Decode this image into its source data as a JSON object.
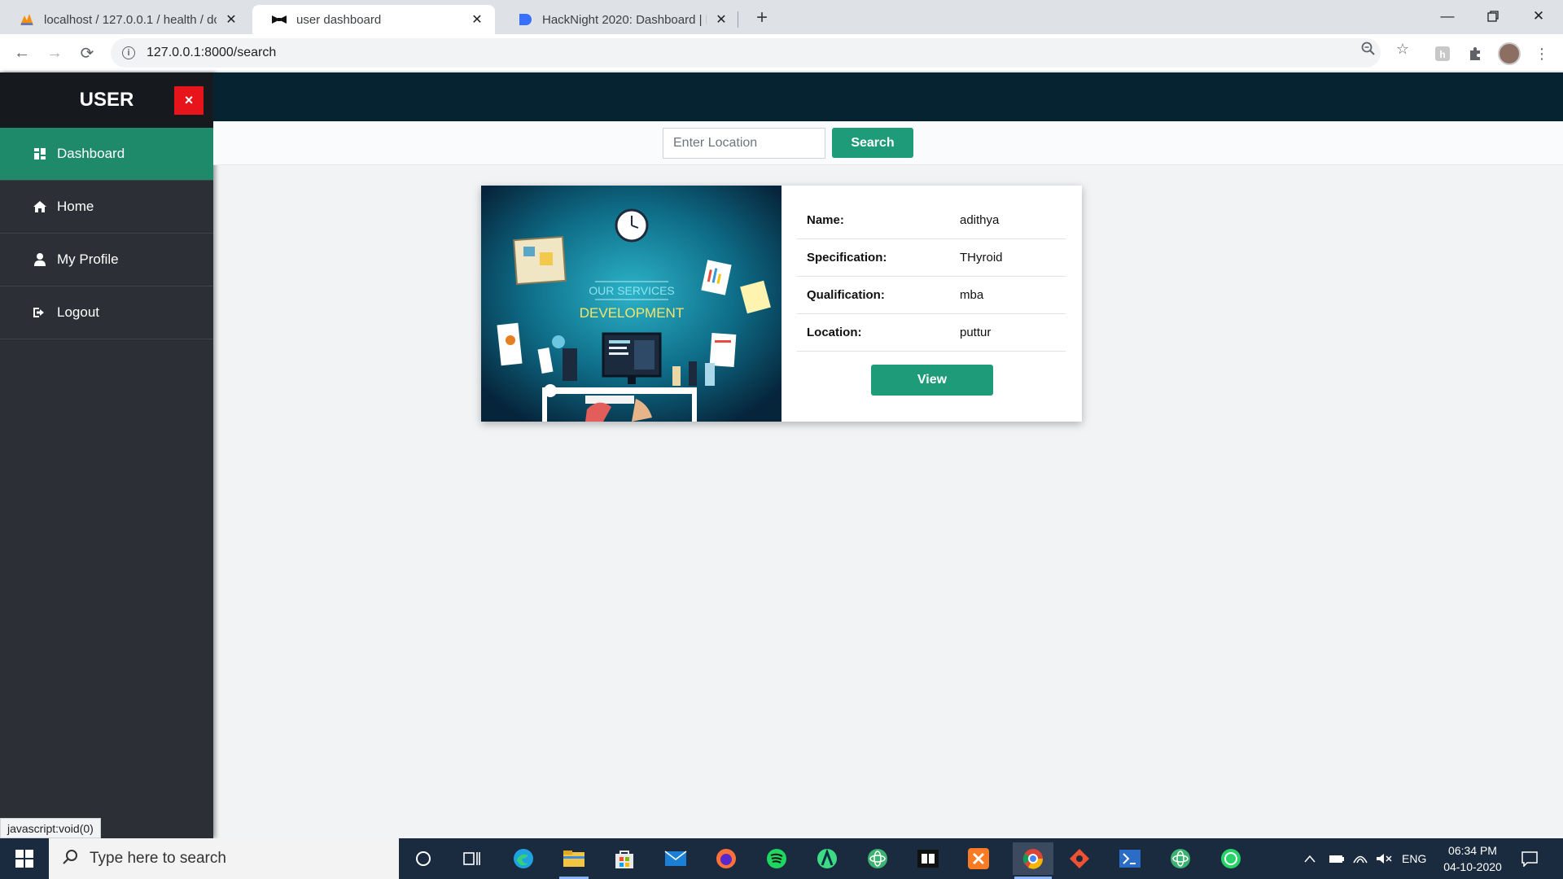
{
  "browser": {
    "tabs": [
      {
        "title": "localhost / 127.0.0.1 / health / dc",
        "favicon": "phpmyadmin-icon"
      },
      {
        "title": "user dashboard",
        "favicon": "bowtie-icon",
        "active": true
      },
      {
        "title": "HackNight 2020: Dashboard | De",
        "favicon": "devfolio-icon"
      }
    ],
    "url": "127.0.0.1:8000/search"
  },
  "sidebar": {
    "title": "USER",
    "close_label": "×",
    "items": [
      {
        "label": "Dashboard",
        "icon": "dashboard-icon",
        "active": true
      },
      {
        "label": "Home",
        "icon": "home-icon"
      },
      {
        "label": "My Profile",
        "icon": "user-icon"
      },
      {
        "label": "Logout",
        "icon": "logout-icon"
      }
    ]
  },
  "search": {
    "placeholder": "Enter Location",
    "button_label": "Search"
  },
  "result_card": {
    "image_caption_top": "OUR SERVICES",
    "image_caption_main": "DEVELOPMENT",
    "rows": [
      {
        "label": "Name:",
        "value": "adithya"
      },
      {
        "label": "Specification:",
        "value": "THyroid"
      },
      {
        "label": "Qualification:",
        "value": "mba"
      },
      {
        "label": "Location:",
        "value": "puttur"
      }
    ],
    "view_label": "View"
  },
  "status_bar": "javascript:void(0)",
  "taskbar": {
    "search_placeholder": "Type here to search",
    "language": "ENG",
    "time": "06:34 PM",
    "date": "04-10-2020"
  },
  "colors": {
    "accent": "#1e9b78",
    "sidebar_bg": "#2c2f35",
    "topbar_bg": "#052330",
    "close_red": "#e8141b"
  }
}
